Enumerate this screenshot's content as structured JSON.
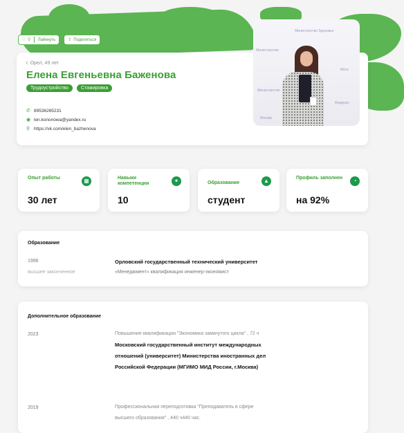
{
  "actions": {
    "like_count": "0",
    "like_label": "Лайкнуть",
    "share_label": "Поделиться"
  },
  "profile": {
    "city_age": "г. Орел, 49 лет",
    "name": "Елена Евгеньевна Баженова",
    "tags": [
      "Трудоустройство",
      "Стажировка"
    ],
    "phone": "89536265231",
    "email": "len.kononowa@yandex.ru",
    "link": "https://vk.com/elen_bazhenova"
  },
  "photo_wall": {
    "t1": "Министерство Здоровья",
    "t2": "Министерство",
    "t3": "Мега",
    "t4": "Министерство",
    "t5": "Федерал",
    "t6": "Москва"
  },
  "stats": [
    {
      "label": "Опыт работы",
      "value": "30 лет",
      "icon": "calendar-icon"
    },
    {
      "label": "Навыки компетенции",
      "value": "10",
      "icon": "skill-icon"
    },
    {
      "label": "Образование",
      "value": "студент",
      "icon": "graduation-cap-icon"
    },
    {
      "label": "Профиль заполнен",
      "value": "на 92%",
      "icon": "progress-icon"
    }
  ],
  "education": {
    "title": "Образование",
    "year": "1996",
    "level": "высшее законченное",
    "institution": "Орловский государственный технический университет",
    "details": "«Менеджмент» квалификация инженер-экономист"
  },
  "additional": {
    "title": "Дополнительное образование",
    "items": [
      {
        "year": "2023",
        "course": "Повышение квалификации \"Экономика замкнутого цикла\" , 72 ч",
        "org1": "Московский государственный институт международных",
        "org2": "отношений (университет) Министерства иностранных дел",
        "org3": "Российской Федерации (МГИМО МИД России, г.Москва)"
      },
      {
        "year": "2019",
        "course1": "Профессиональная переподготовка \"Преподаватель в сфере",
        "course2": "высшего образования\" , 440 ч440 час."
      }
    ]
  },
  "colors": {
    "accent": "#3c9e35",
    "brush": "#5bb552",
    "icon_bg": "#1a9a4a"
  }
}
